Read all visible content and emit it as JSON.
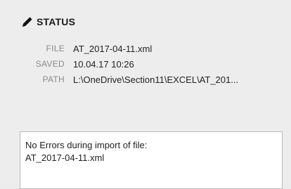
{
  "status": {
    "title": "STATUS",
    "icon": "pencil-icon"
  },
  "info": [
    {
      "label": "FILE",
      "value": "AT_2017-04-11.xml"
    },
    {
      "label": "SAVED",
      "value": "10.04.17 10:26"
    },
    {
      "label": "PATH",
      "value": "L:\\OneDrive\\Section11\\EXCEL\\AT_201..."
    }
  ],
  "messages": {
    "text": "No Errors during import of file:\nAT_2017-04-11.xml"
  }
}
